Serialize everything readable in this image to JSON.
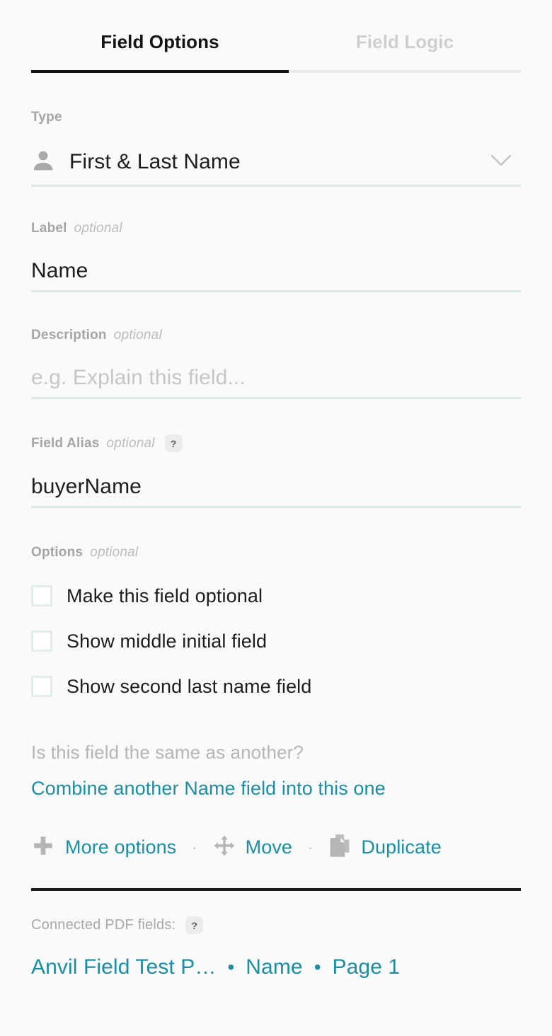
{
  "tabs": [
    {
      "label": "Field Options",
      "active": true
    },
    {
      "label": "Field Logic",
      "active": false
    }
  ],
  "type_field": {
    "label": "Type",
    "icon": "person-icon",
    "value": "First & Last Name",
    "chevron": "chevron-down-icon"
  },
  "label_field": {
    "label": "Label",
    "optional": "optional",
    "value": "Name"
  },
  "description_field": {
    "label": "Description",
    "optional": "optional",
    "placeholder": "e.g. Explain this field...",
    "value": ""
  },
  "alias_field": {
    "label": "Field Alias",
    "optional": "optional",
    "help": "?",
    "value": "buyerName"
  },
  "options": {
    "label": "Options",
    "optional": "optional",
    "items": [
      {
        "label": "Make this field optional",
        "checked": false
      },
      {
        "label": "Show middle initial field",
        "checked": false
      },
      {
        "label": "Show second last name field",
        "checked": false
      }
    ]
  },
  "combine": {
    "question": "Is this field the same as another?",
    "link": "Combine another Name field into this one"
  },
  "actions": [
    {
      "label": "More options",
      "icon": "plus-icon"
    },
    {
      "label": "Move",
      "icon": "move-icon"
    },
    {
      "label": "Duplicate",
      "icon": "duplicate-icon"
    }
  ],
  "action_separator": "·",
  "connected_pdf": {
    "label": "Connected PDF fields:",
    "help": "?",
    "items": [
      "Anvil Field Test P…",
      "Name",
      "Page 1"
    ],
    "separator": "•"
  },
  "colors": {
    "accent_teal": "#1b8ea3",
    "underline_mint": "#dfeae6",
    "tab_active": "#111111",
    "tab_inactive": "#cfcfcf",
    "background": "#fafafa"
  }
}
